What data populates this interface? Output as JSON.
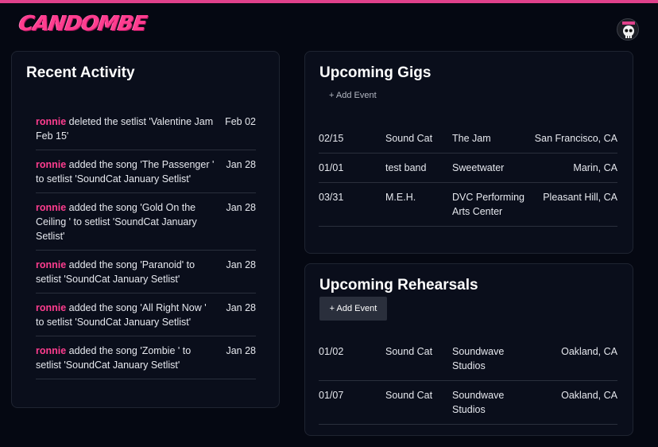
{
  "brand": {
    "logo_text": "CANDOMBE",
    "accent": "#e0418b"
  },
  "user": {
    "avatar_icon": "skull-avatar-icon"
  },
  "recent_activity": {
    "title": "Recent Activity",
    "items": [
      {
        "user": "ronnie",
        "text": " deleted the setlist 'Valentine Jam Feb 15'",
        "date": "Feb 02"
      },
      {
        "user": "ronnie",
        "text": " added the song 'The Passenger ' to setlist 'SoundCat January Setlist'",
        "date": "Jan 28"
      },
      {
        "user": "ronnie",
        "text": " added the song 'Gold On the Ceiling ' to setlist 'SoundCat January Setlist'",
        "date": "Jan 28"
      },
      {
        "user": "ronnie",
        "text": " added the song 'Paranoid' to setlist 'SoundCat January Setlist'",
        "date": "Jan 28"
      },
      {
        "user": "ronnie",
        "text": " added the song 'All Right Now ' to setlist 'SoundCat January Setlist'",
        "date": "Jan 28"
      },
      {
        "user": "ronnie",
        "text": " added the song 'Zombie ' to setlist 'SoundCat January Setlist'",
        "date": "Jan 28"
      }
    ]
  },
  "gigs": {
    "title": "Upcoming Gigs",
    "add_label": "+ Add Event",
    "rows": [
      {
        "date": "02/15",
        "band": "Sound Cat",
        "venue": "The Jam",
        "location": "San Francisco, CA"
      },
      {
        "date": "01/01",
        "band": "test band",
        "venue": "Sweetwater",
        "location": "Marin, CA"
      },
      {
        "date": "03/31",
        "band": "M.E.H.",
        "venue": "DVC Performing Arts Center",
        "location": "Pleasant Hill, CA"
      }
    ]
  },
  "rehearsals": {
    "title": "Upcoming Rehearsals",
    "add_label": "+ Add Event",
    "rows": [
      {
        "date": "01/02",
        "band": "Sound Cat",
        "venue": "Soundwave Studios",
        "location": "Oakland, CA"
      },
      {
        "date": "01/07",
        "band": "Sound Cat",
        "venue": "Soundwave Studios",
        "location": "Oakland, CA"
      }
    ]
  }
}
